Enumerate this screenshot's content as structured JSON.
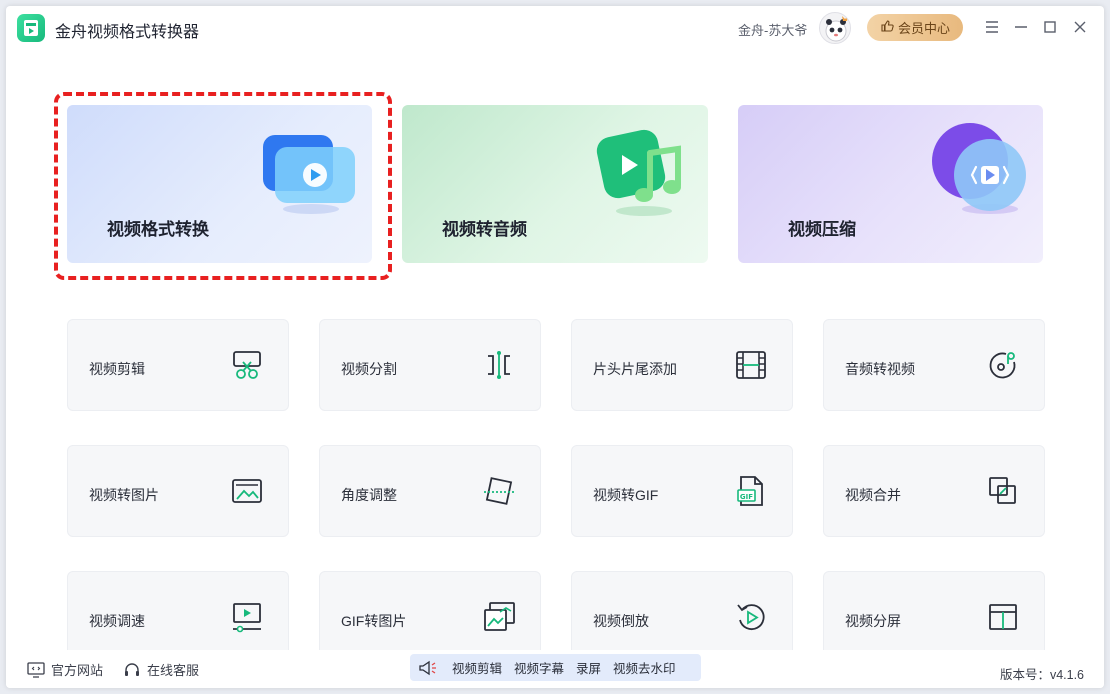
{
  "app": {
    "title": "金舟视频格式转换器"
  },
  "header": {
    "user_name": "金舟-苏大爷",
    "vip_label": "会员中心"
  },
  "feature_cards": [
    {
      "label": "视频格式转换"
    },
    {
      "label": "视频转音频"
    },
    {
      "label": "视频压缩"
    }
  ],
  "tools": [
    {
      "label": "视频剪辑",
      "icon": "scissors-icon"
    },
    {
      "label": "视频分割",
      "icon": "split-icon"
    },
    {
      "label": "片头片尾添加",
      "icon": "film-strip-icon"
    },
    {
      "label": "音频转视频",
      "icon": "music-disc-icon"
    },
    {
      "label": "视频转图片",
      "icon": "image-icon"
    },
    {
      "label": "角度调整",
      "icon": "rotate-frame-icon"
    },
    {
      "label": "视频转GIF",
      "icon": "gif-file-icon"
    },
    {
      "label": "视频合并",
      "icon": "merge-icon"
    },
    {
      "label": "视频调速",
      "icon": "speed-icon"
    },
    {
      "label": "GIF转图片",
      "icon": "gif-image-icon"
    },
    {
      "label": "视频倒放",
      "icon": "reverse-play-icon"
    },
    {
      "label": "视频分屏",
      "icon": "split-screen-icon"
    }
  ],
  "footer": {
    "website": "官方网站",
    "support": "在线客服",
    "promo_links": [
      "视频剪辑",
      "视频字幕",
      "录屏",
      "视频去水印"
    ],
    "version": "版本号：v4.1.6"
  },
  "colors": {
    "accent_green": "#17b97c",
    "highlight_red": "#e82020",
    "vip_gold": "#e8b97e"
  }
}
